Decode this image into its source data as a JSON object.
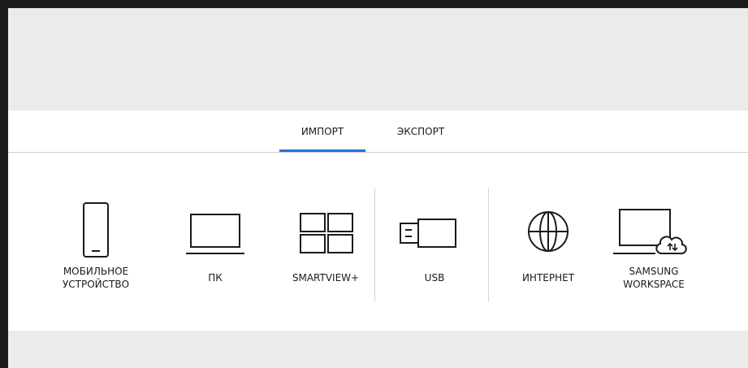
{
  "tabs": {
    "import_label": "ИМПОРТ",
    "export_label": "ЭКСПОРТ",
    "active": "import"
  },
  "sources": [
    {
      "label": "МОБИЛЬНОЕ\nУСТРОЙСТВО",
      "icon": "smartphone-icon"
    },
    {
      "label": "ПК",
      "icon": "monitor-icon"
    },
    {
      "label": "SMARTVIEW+",
      "icon": "multi-view-grid-icon"
    },
    {
      "label": "USB",
      "icon": "usb-stick-icon"
    },
    {
      "label": "ИНТЕРНЕТ",
      "icon": "globe-icon"
    },
    {
      "label": "SAMSUNG\nWORKSPACE",
      "icon": "laptop-cloud-icon"
    }
  ],
  "colors": {
    "accent": "#1f74d6",
    "frame": "#1c1c1c",
    "background": "#ebebeb",
    "panel": "#ffffff"
  }
}
